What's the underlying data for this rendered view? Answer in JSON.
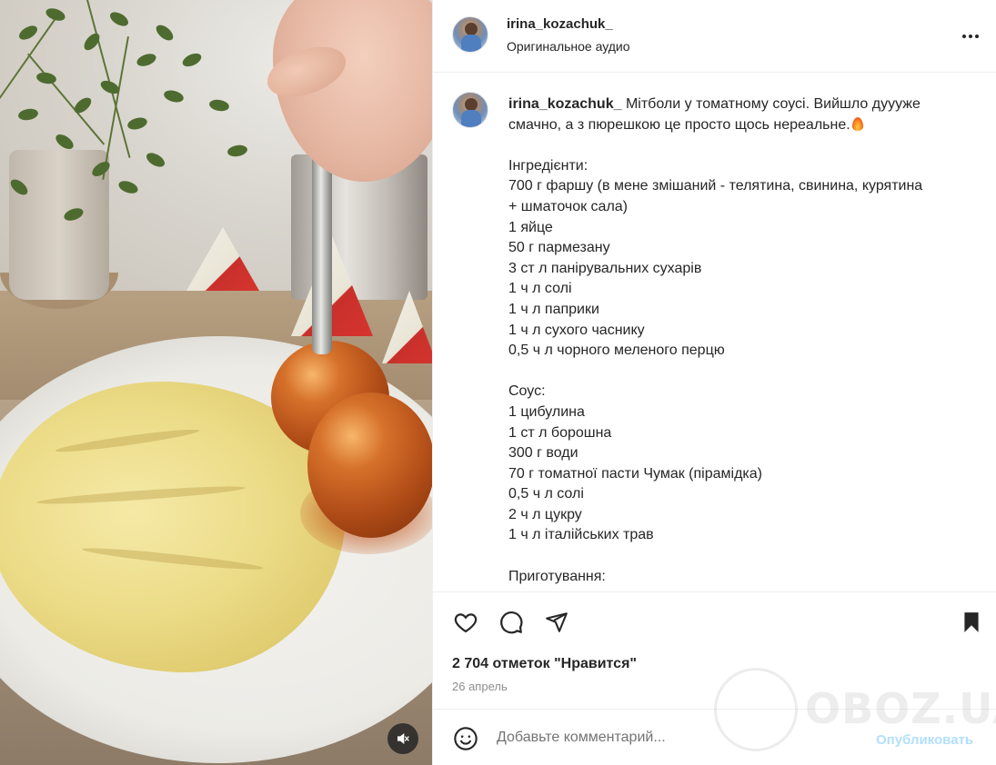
{
  "post": {
    "username": "irina_kozachuk_",
    "audio_label": "Оригинальное аудио",
    "caption_username": "irina_kozachuk_",
    "caption_body": "Мітболи у томатному соусі. Вийшло дуууже смачно, а з пюрешкою це просто щось нереальне.",
    "caption_lines": [
      "",
      "Інгредієнти:",
      "700 г фаршу (в мене змішаний - телятина, свинина, курятина",
      "+ шматочок сала)",
      "1 яйце",
      "50 г пармезану",
      "3 ст л панірувальних сухарів",
      "1 ч л солі",
      "1 ч л паприки",
      "1 ч л сухого часнику",
      "0,5 ч л чорного меленого перцю",
      "",
      "Соус:",
      "1 цибулина",
      "1 ст л борошна",
      "300 г води",
      "70 г томатної пасти Чумак (пірамідка)",
      "0,5 ч л солі",
      "2 ч л цукру",
      "1 ч л італійських трав",
      "",
      "Приготування:"
    ],
    "likes": "2 704 отметок \"Нравится\"",
    "date": "26 апрель"
  },
  "comment": {
    "placeholder": "Добавьте комментарий...",
    "publish_label": "Опубликовать"
  },
  "icons": {
    "like": "heart-icon",
    "comment": "comment-icon",
    "share": "share-icon",
    "save": "bookmark-icon",
    "emoji": "emoji-icon",
    "more": "more-icon",
    "mute": "muted-speaker-icon"
  },
  "watermark": "OBOZ.UA",
  "colors": {
    "text": "#262626",
    "secondary": "#8e8e8e",
    "publish": "#b2dffc",
    "divider": "#efefef"
  }
}
